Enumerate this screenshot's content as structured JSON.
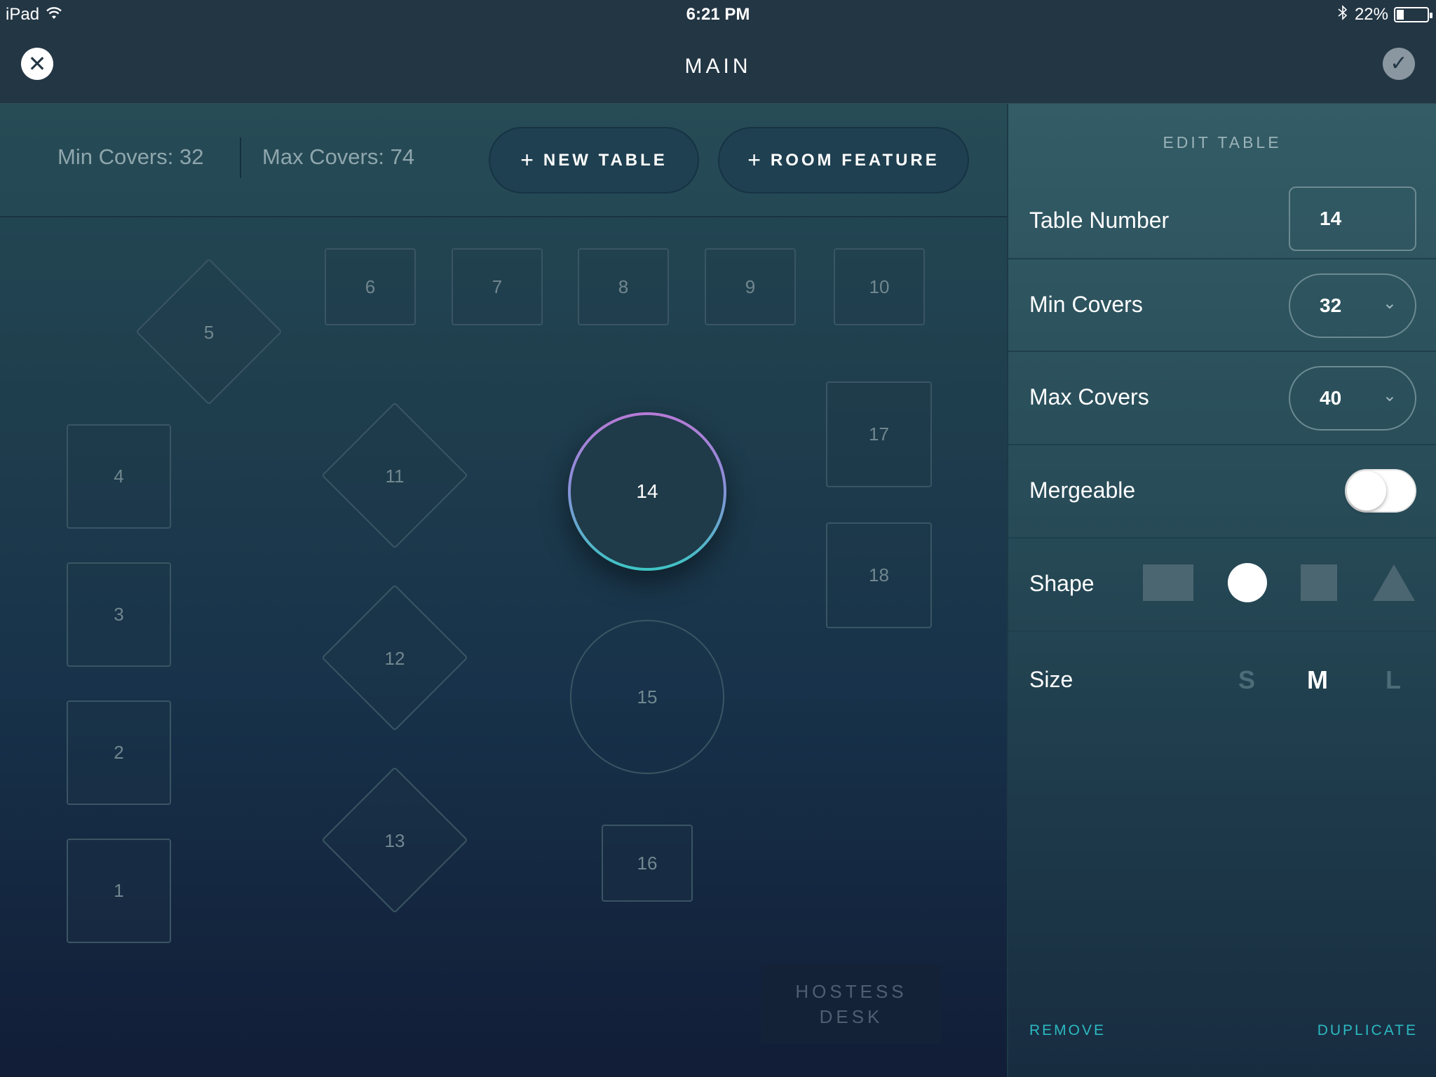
{
  "status_bar": {
    "device": "iPad",
    "time": "6:21 PM",
    "battery": "22%"
  },
  "nav": {
    "title": "MAIN"
  },
  "toolbar": {
    "min_covers": "Min Covers: 32",
    "max_covers": "Max Covers: 74",
    "new_table": "NEW TABLE",
    "room_feature": "ROOM FEATURE"
  },
  "floor": {
    "tables": {
      "t1": "1",
      "t2": "2",
      "t3": "3",
      "t4": "4",
      "t5": "5",
      "t6": "6",
      "t7": "7",
      "t8": "8",
      "t9": "9",
      "t10": "10",
      "t11": "11",
      "t12": "12",
      "t13": "13",
      "t14": "14",
      "t15": "15",
      "t16": "16",
      "t17": "17",
      "t18": "18"
    },
    "hostess_desk_line1": "HOSTESS",
    "hostess_desk_line2": "DESK"
  },
  "panel": {
    "title": "EDIT TABLE",
    "table_number_label": "Table Number",
    "table_number_value": "14",
    "min_covers_label": "Min Covers",
    "min_covers_value": "32",
    "max_covers_label": "Max Covers",
    "max_covers_value": "40",
    "mergeable_label": "Mergeable",
    "mergeable_on": false,
    "shape_label": "Shape",
    "shape_options": [
      "rectangle",
      "circle",
      "square",
      "triangle"
    ],
    "shape_selected": "circle",
    "size_label": "Size",
    "size_options": [
      "S",
      "M",
      "L"
    ],
    "size_selected": "M",
    "remove": "REMOVE",
    "duplicate": "DUPLICATE"
  },
  "colors": {
    "accent": "#2bb9c1",
    "selected_ring_top": "#b77ad6",
    "selected_ring_bottom": "#3ec5c4"
  }
}
